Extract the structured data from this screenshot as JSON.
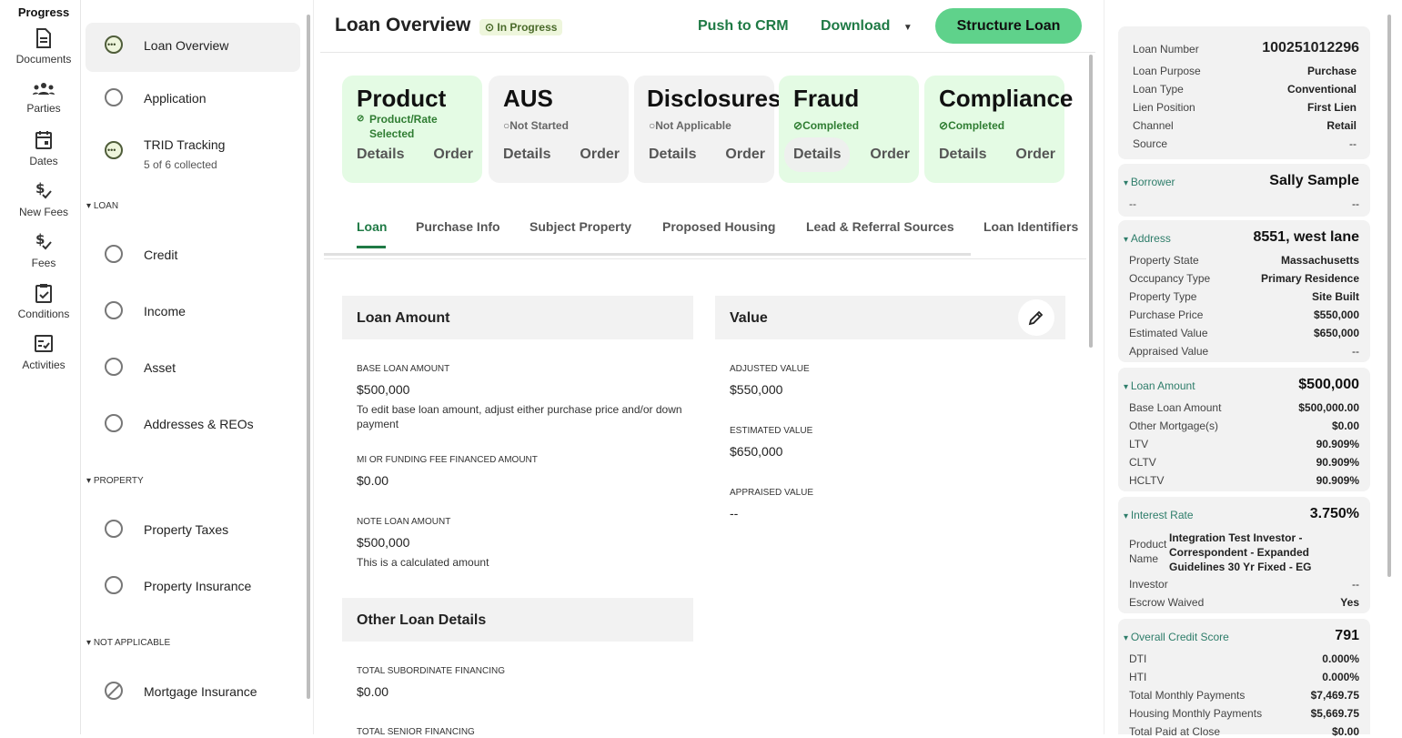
{
  "rail": {
    "items": [
      {
        "label": "Progress",
        "icon": "progress-icon"
      },
      {
        "label": "Documents",
        "icon": "document-icon"
      },
      {
        "label": "Parties",
        "icon": "parties-icon"
      },
      {
        "label": "Dates",
        "icon": "calendar-icon"
      },
      {
        "label": "New Fees",
        "icon": "dollar-check-icon"
      },
      {
        "label": "Fees",
        "icon": "dollar-check-icon"
      },
      {
        "label": "Conditions",
        "icon": "clipboard-check-icon"
      },
      {
        "label": "Activities",
        "icon": "checklist-icon"
      }
    ]
  },
  "progress": {
    "items": [
      {
        "label": "Loan Overview"
      },
      {
        "label": "Application"
      },
      {
        "label": "TRID Tracking",
        "sub": "5 of 6 collected"
      },
      {
        "label": "Credit"
      },
      {
        "label": "Income"
      },
      {
        "label": "Asset"
      },
      {
        "label": "Addresses & REOs"
      },
      {
        "label": "Property Taxes"
      },
      {
        "label": "Property Insurance"
      },
      {
        "label": "Mortgage Insurance"
      }
    ],
    "sections": {
      "loan": "LOAN",
      "property": "PROPERTY",
      "na": "NOT APPLICABLE"
    }
  },
  "header": {
    "title": "Loan Overview",
    "status": "In Progress",
    "push_crm": "Push to CRM",
    "download": "Download",
    "structure": "Structure Loan",
    "accent": "#5fd28b"
  },
  "cards": [
    {
      "title": "Product",
      "status": "Product/Rate Selected",
      "details": "Details",
      "order": "Order"
    },
    {
      "title": "AUS",
      "status": "Not Started",
      "details": "Details",
      "order": "Order"
    },
    {
      "title": "Disclosures",
      "status": "Not Applicable",
      "details": "Details",
      "order": "Order"
    },
    {
      "title": "Fraud",
      "status": "Completed",
      "details": "Details",
      "order": "Order"
    },
    {
      "title": "Compliance",
      "status": "Completed",
      "details": "Details",
      "order": "Order"
    }
  ],
  "tabs": [
    "Loan",
    "Purchase Info",
    "Subject Property",
    "Proposed Housing",
    "Lead & Referral Sources",
    "Loan Identifiers"
  ],
  "loan_amount": {
    "header": "Loan Amount",
    "base_label": "BASE LOAN AMOUNT",
    "base_value": "$500,000",
    "base_note": "To edit base loan amount, adjust either purchase price and/or down payment",
    "mi_label": "MI OR FUNDING FEE FINANCED AMOUNT",
    "mi_value": "$0.00",
    "note_label": "NOTE LOAN AMOUNT",
    "note_value": "$500,000",
    "note_note": "This is a calculated amount"
  },
  "value": {
    "header": "Value",
    "adjusted_label": "ADJUSTED VALUE",
    "adjusted_value": "$550,000",
    "estimated_label": "ESTIMATED VALUE",
    "estimated_value": "$650,000",
    "appraised_label": "APPRAISED VALUE",
    "appraised_value": "--"
  },
  "other": {
    "header": "Other Loan Details",
    "sub_label": "TOTAL SUBORDINATE FINANCING",
    "sub_value": "$0.00",
    "senior_label": "TOTAL SENIOR FINANCING"
  },
  "summary": {
    "loan_number_label": "Loan Number",
    "loan_number": "100251012296",
    "rows1": [
      {
        "k": "Loan Purpose",
        "v": "Purchase"
      },
      {
        "k": "Loan Type",
        "v": "Conventional"
      },
      {
        "k": "Lien Position",
        "v": "First Lien"
      },
      {
        "k": "Channel",
        "v": "Retail"
      },
      {
        "k": "Source",
        "v": "--"
      }
    ],
    "borrower": {
      "h": "Borrower",
      "v": "Sally Sample",
      "k2": "--",
      "v2": "--"
    },
    "address": {
      "h": "Address",
      "v": "8551, west lane",
      "rows": [
        {
          "k": "Property State",
          "v": "Massachusetts"
        },
        {
          "k": "Occupancy Type",
          "v": "Primary Residence"
        },
        {
          "k": "Property Type",
          "v": "Site Built"
        },
        {
          "k": "Purchase Price",
          "v": "$550,000"
        },
        {
          "k": "Estimated Value",
          "v": "$650,000"
        },
        {
          "k": "Appraised Value",
          "v": "--"
        }
      ]
    },
    "loan_amount": {
      "h": "Loan Amount",
      "v": "$500,000",
      "rows": [
        {
          "k": "Base Loan Amount",
          "v": "$500,000.00"
        },
        {
          "k": "Other Mortgage(s)",
          "v": "$0.00"
        },
        {
          "k": "LTV",
          "v": "90.909%"
        },
        {
          "k": "CLTV",
          "v": "90.909%"
        },
        {
          "k": "HCLTV",
          "v": "90.909%"
        }
      ]
    },
    "interest": {
      "h": "Interest Rate",
      "v": "3.750%",
      "product_k1": "Product",
      "product_k2": "Name",
      "product_v": "Integration Test Investor - Correspondent - Expanded Guidelines 30 Yr Fixed - EG",
      "rows": [
        {
          "k": "Investor",
          "v": "--"
        },
        {
          "k": "Escrow Waived",
          "v": "Yes"
        }
      ]
    },
    "credit": {
      "h": "Overall Credit Score",
      "v": "791",
      "rows": [
        {
          "k": "DTI",
          "v": "0.000%"
        },
        {
          "k": "HTI",
          "v": "0.000%"
        },
        {
          "k": "Total Monthly Payments",
          "v": "$7,469.75"
        },
        {
          "k": "Housing Monthly Payments",
          "v": "$5,669.75"
        },
        {
          "k": "Total Paid at Close",
          "v": "$0.00"
        }
      ]
    }
  }
}
